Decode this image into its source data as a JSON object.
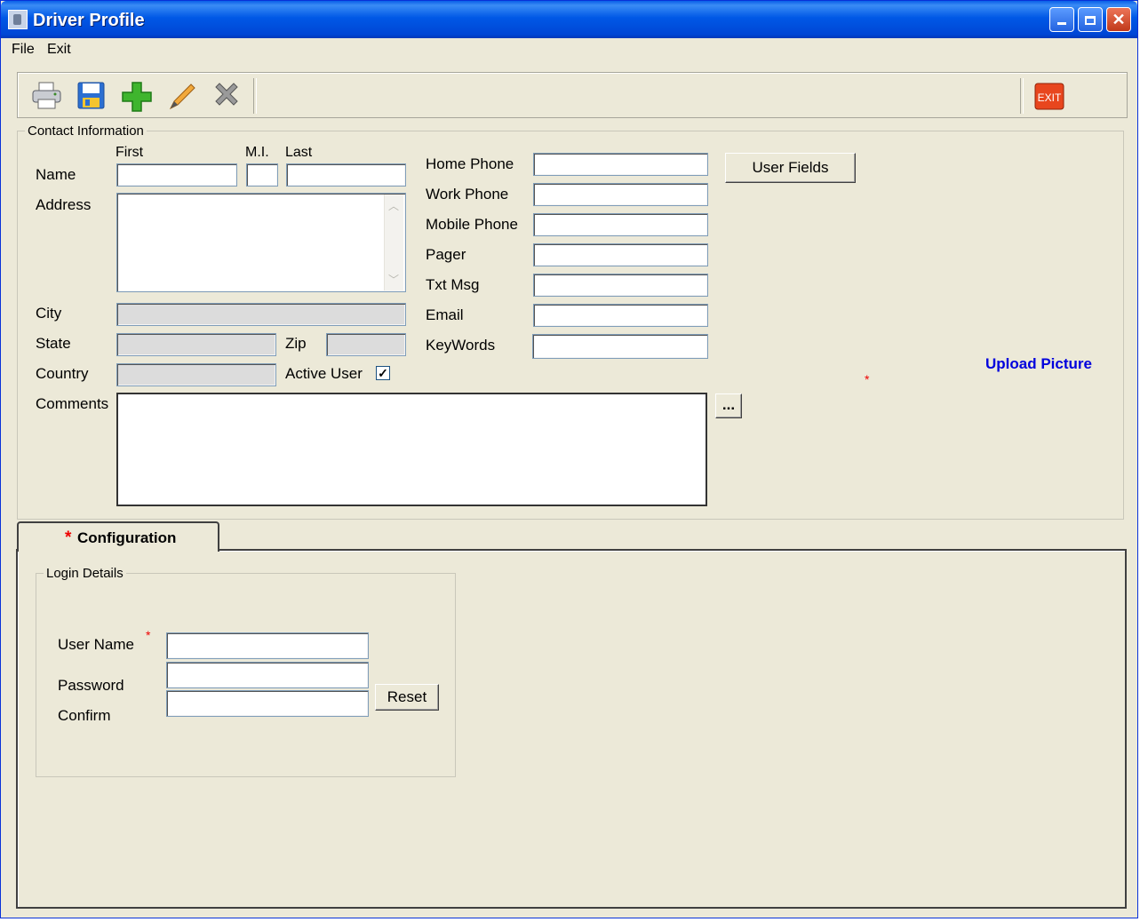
{
  "window": {
    "title": "Driver Profile"
  },
  "menu": {
    "file": "File",
    "exit": "Exit"
  },
  "toolbar": {
    "icons": [
      "printer-icon",
      "save-icon",
      "add-icon",
      "edit-icon",
      "delete-icon",
      "exit-icon"
    ],
    "exit_label": "EXIT"
  },
  "contact": {
    "legend": "Contact Information",
    "first_label": "First",
    "mi_label": "M.I.",
    "last_label": "Last",
    "name_label": "Name",
    "address_label": "Address",
    "city_label": "City",
    "state_label": "State",
    "zip_label": "Zip",
    "country_label": "Country",
    "active_user_label": "Active User",
    "active_user_checked": "✓",
    "comments_label": "Comments",
    "home_phone_label": "Home Phone",
    "work_phone_label": "Work Phone",
    "mobile_phone_label": "Mobile Phone",
    "pager_label": "Pager",
    "txt_msg_label": "Txt Msg",
    "email_label": "Email",
    "keywords_label": "KeyWords",
    "user_fields_button": "User Fields",
    "ellipsis_button": "...",
    "upload_picture": "Upload Picture",
    "required_marker": "*"
  },
  "tabs": {
    "configuration": "Configuration",
    "star": "*"
  },
  "login": {
    "legend": "Login Details",
    "username_label": "User Name",
    "password_label": "Password",
    "confirm_label": "Confirm",
    "reset_button": "Reset",
    "required_marker": "*"
  }
}
